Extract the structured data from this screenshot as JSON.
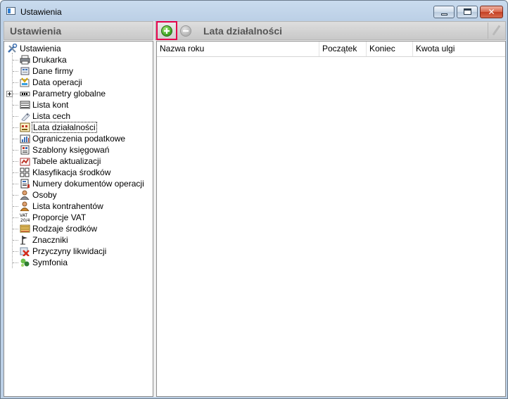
{
  "window": {
    "title": "Ustawienia",
    "minimize_glyph": "_",
    "maximize_glyph": "□",
    "close_glyph": "✕"
  },
  "left_panel": {
    "header": "Ustawienia"
  },
  "right_panel": {
    "header": "Lata działalności",
    "toolbar": {
      "add_icon": "add-green-circle",
      "remove_icon": "remove-grey-circle",
      "edit_icon": "pencil"
    },
    "columns": [
      "Nazwa roku",
      "Początek",
      "Koniec",
      "Kwota ulgi"
    ],
    "rows": []
  },
  "tree": {
    "root": "Ustawienia",
    "items": [
      {
        "label": "Drukarka",
        "icon": "printer"
      },
      {
        "label": "Dane firmy",
        "icon": "company"
      },
      {
        "label": "Data operacji",
        "icon": "calendar-date"
      },
      {
        "label": "Parametry globalne",
        "icon": "parameters",
        "expandable": true
      },
      {
        "label": "Lista kont",
        "icon": "accounts"
      },
      {
        "label": "Lista cech",
        "icon": "tag"
      },
      {
        "label": "Lata działalności",
        "icon": "years",
        "selected": true
      },
      {
        "label": "Ograniczenia podatkowe",
        "icon": "tax-chart"
      },
      {
        "label": "Szablony księgowań",
        "icon": "templates"
      },
      {
        "label": "Tabele aktualizacji",
        "icon": "update-table"
      },
      {
        "label": "Klasyfikacja środków",
        "icon": "classification"
      },
      {
        "label": "Numery dokumentów operacji",
        "icon": "document-numbers"
      },
      {
        "label": "Osoby",
        "icon": "person"
      },
      {
        "label": "Lista kontrahentów",
        "icon": "contractor"
      },
      {
        "label": "Proporcje VAT",
        "icon": "vat"
      },
      {
        "label": "Rodzaje środków",
        "icon": "asset-types"
      },
      {
        "label": "Znaczniki",
        "icon": "flag"
      },
      {
        "label": "Przyczyny likwidacji",
        "icon": "delete-x"
      },
      {
        "label": "Symfonia",
        "icon": "symfonia"
      }
    ]
  },
  "colors": {
    "add_highlight": "#e3004a",
    "add_green": "#44a82a",
    "header_text": "#555555"
  }
}
